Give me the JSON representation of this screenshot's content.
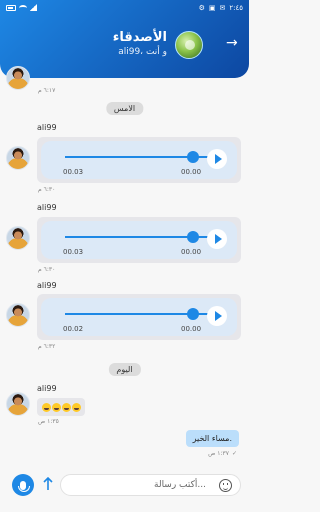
{
  "statusbar": {
    "time": "٢:٤٥",
    "left_icons": [
      "battery-icon",
      "wifi-icon",
      "signal-icon"
    ],
    "right_icons": [
      "settings-icon",
      "image-icon",
      "mail-icon"
    ]
  },
  "header": {
    "title": "الأصدقاء",
    "subtitle": "ali99، و أنت",
    "back_icon": "arrow-right-icon"
  },
  "chat": {
    "top_meta": "٦:١٧ م",
    "separators": {
      "yesterday": "الامس",
      "today": "اليوم"
    },
    "voice_messages": [
      {
        "sender": "ali99",
        "current_time": "00.03",
        "duration": "00.00",
        "progress": 0.85,
        "meta": "٦:٣٠ م"
      },
      {
        "sender": "ali99",
        "current_time": "00.03",
        "duration": "00.00",
        "progress": 0.85,
        "meta": "٦:٣٠ م"
      },
      {
        "sender": "ali99",
        "current_time": "00.02",
        "duration": "00.00",
        "progress": 0.85,
        "meta": "٦:٣٢ م"
      }
    ],
    "emoji_message": {
      "sender": "ali99",
      "meta": "١:٣٥ ص",
      "emoji_count": 4
    },
    "outgoing": {
      "text": "مساء الخير.",
      "meta": "١:٣٧ ص"
    }
  },
  "composer": {
    "placeholder": "أكتب رسالة...",
    "mic_icon": "mic-icon",
    "send_icon": "send-icon",
    "emoji_icon": "smile-icon"
  },
  "colors": {
    "primary": "#1e88e5",
    "primary_dark": "#0d47a1",
    "bubble_out": "#bbdefb",
    "bubble_in": "#e6e6ea"
  }
}
